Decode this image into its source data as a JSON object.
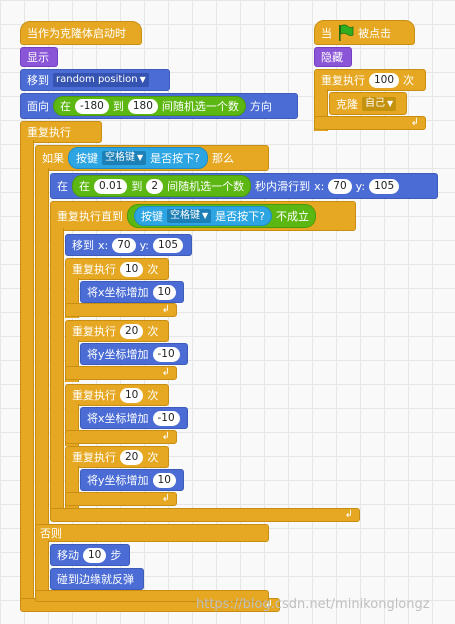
{
  "script_clone": {
    "hat": "当作为克隆体启动时",
    "show": "显示",
    "goto_label": "移到",
    "goto_target": "random position",
    "point_label": "面向",
    "point_in": "在",
    "point_min": "-180",
    "point_to": "到",
    "point_max": "180",
    "point_pick": "间随机选一个数",
    "point_dir": "方向",
    "forever": "重复执行",
    "if_label": "如果",
    "key_label": "按键",
    "key_value": "空格键",
    "key_pressed": "是否按下?",
    "then": "那么",
    "glide_in": "在",
    "glide_in2": "在",
    "glide_min": "0.01",
    "glide_to": "到",
    "glide_max": "2",
    "glide_pick": "间随机选一个数",
    "glide_secs": "秒内滑行到",
    "glide_x_label": "x:",
    "glide_x": "70",
    "glide_y_label": "y:",
    "glide_y": "105",
    "until_label": "重复执行直到",
    "until_key_label": "按键",
    "until_key_value": "空格键",
    "until_pressed": "是否按下?",
    "until_not": "不成立",
    "goto_xy_label": "移到",
    "goto_x_label": "x:",
    "goto_x": "70",
    "goto_y_label": "y:",
    "goto_y": "105",
    "repeat1_label": "重复执行",
    "repeat1_count": "10",
    "repeat1_unit": "次",
    "changex1_label": "将x坐标增加",
    "changex1_value": "10",
    "repeat2_label": "重复执行",
    "repeat2_count": "20",
    "repeat2_unit": "次",
    "changey1_label": "将y坐标增加",
    "changey1_value": "-10",
    "repeat3_label": "重复执行",
    "repeat3_count": "10",
    "repeat3_unit": "次",
    "changex2_label": "将x坐标增加",
    "changex2_value": "-10",
    "repeat4_label": "重复执行",
    "repeat4_count": "20",
    "repeat4_unit": "次",
    "changey2_label": "将y坐标增加",
    "changey2_value": "10",
    "else": "否则",
    "move_label": "移动",
    "move_steps": "10",
    "move_unit": "步",
    "bounce": "碰到边缘就反弹"
  },
  "script_flag": {
    "hat_when": "当",
    "hat_clicked": "被点击",
    "hide": "隐藏",
    "repeat_label": "重复执行",
    "repeat_count": "100",
    "repeat_unit": "次",
    "clone_label": "克隆",
    "clone_target": "自己"
  },
  "watermark": "https://blog.csdn.net/minikonglongz",
  "icons": {
    "flag": "green-flag-icon",
    "loop": "loop-arrow-icon",
    "dropdown": "dropdown-triangle-icon"
  },
  "colors": {
    "control": "#e6a822",
    "motion": "#4a6cd4",
    "looks": "#8a55d7",
    "sensing": "#2ca5e2",
    "operators": "#5cb712",
    "flag": "#2fae1f"
  }
}
